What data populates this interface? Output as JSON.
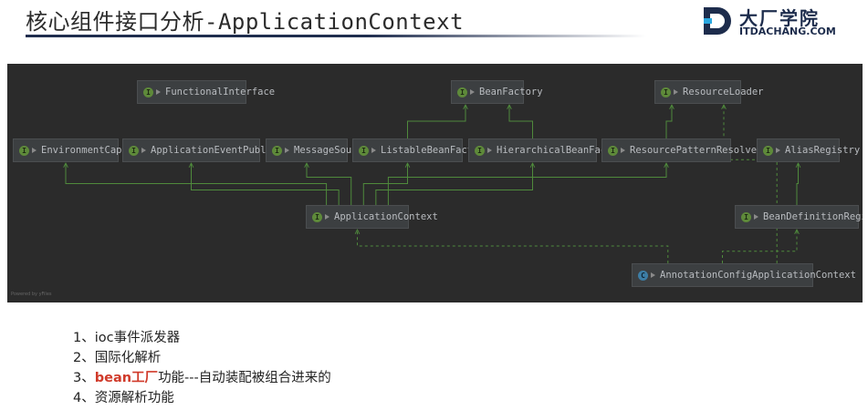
{
  "slide": {
    "title": "核心组件接口分析-ApplicationContext"
  },
  "logo": {
    "name": "大厂学院",
    "url": "ITDACHANG.COM"
  },
  "diagram": {
    "nodes": [
      {
        "id": "FunctionalInterface",
        "label": "FunctionalInterface",
        "kind": "interface"
      },
      {
        "id": "BeanFactory",
        "label": "BeanFactory",
        "kind": "interface"
      },
      {
        "id": "ResourceLoader",
        "label": "ResourceLoader",
        "kind": "interface"
      },
      {
        "id": "EnvironmentCapable",
        "label": "EnvironmentCapable",
        "kind": "interface"
      },
      {
        "id": "ApplicationEventPublisher",
        "label": "ApplicationEventPublisher",
        "kind": "interface"
      },
      {
        "id": "MessageSource",
        "label": "MessageSource",
        "kind": "interface"
      },
      {
        "id": "ListableBeanFactory",
        "label": "ListableBeanFactory",
        "kind": "interface"
      },
      {
        "id": "HierarchicalBeanFactory",
        "label": "HierarchicalBeanFactory",
        "kind": "interface"
      },
      {
        "id": "ResourcePatternResolver",
        "label": "ResourcePatternResolver",
        "kind": "interface"
      },
      {
        "id": "AliasRegistry",
        "label": "AliasRegistry",
        "kind": "interface"
      },
      {
        "id": "ApplicationContext",
        "label": "ApplicationContext",
        "kind": "interface"
      },
      {
        "id": "BeanDefinitionRegistry",
        "label": "BeanDefinitionRegistry",
        "kind": "interface"
      },
      {
        "id": "AnnotationConfigApplicationContext",
        "label": "AnnotationConfigApplicationContext",
        "kind": "class"
      }
    ],
    "edges": [
      {
        "from": "ListableBeanFactory",
        "to": "BeanFactory",
        "style": "solid"
      },
      {
        "from": "HierarchicalBeanFactory",
        "to": "BeanFactory",
        "style": "solid"
      },
      {
        "from": "ResourcePatternResolver",
        "to": "ResourceLoader",
        "style": "solid"
      },
      {
        "from": "ApplicationContext",
        "to": "EnvironmentCapable",
        "style": "solid"
      },
      {
        "from": "ApplicationContext",
        "to": "ApplicationEventPublisher",
        "style": "solid"
      },
      {
        "from": "ApplicationContext",
        "to": "MessageSource",
        "style": "solid"
      },
      {
        "from": "ApplicationContext",
        "to": "ListableBeanFactory",
        "style": "solid"
      },
      {
        "from": "ApplicationContext",
        "to": "HierarchicalBeanFactory",
        "style": "solid"
      },
      {
        "from": "ApplicationContext",
        "to": "ResourcePatternResolver",
        "style": "solid"
      },
      {
        "from": "BeanDefinitionRegistry",
        "to": "AliasRegistry",
        "style": "solid"
      },
      {
        "from": "AnnotationConfigApplicationContext",
        "to": "ApplicationContext",
        "style": "dashed"
      },
      {
        "from": "AnnotationConfigApplicationContext",
        "to": "BeanDefinitionRegistry",
        "style": "dashed"
      },
      {
        "from": "AnnotationConfigApplicationContext",
        "to": "ResourceLoader",
        "style": "dashed"
      }
    ],
    "colors": {
      "background": "#2b2b2b",
      "node": "#3c3f41",
      "edge": "#4f8a3c",
      "interface_icon": "#5e8a3a",
      "class_icon": "#3d7ea6"
    },
    "icons": {
      "interface": "interface-icon",
      "class": "class-icon"
    },
    "watermark": "Powered by yFiles"
  },
  "notes": [
    {
      "num": "1、",
      "text": "ioc事件派发器"
    },
    {
      "num": "2、",
      "text": "国际化解析"
    },
    {
      "num": "3、",
      "highlight": "bean工厂",
      "text": "功能---自动装配被组合进来的"
    },
    {
      "num": "4、",
      "text": "资源解析功能"
    }
  ],
  "highlight_color": "#d03a2a"
}
